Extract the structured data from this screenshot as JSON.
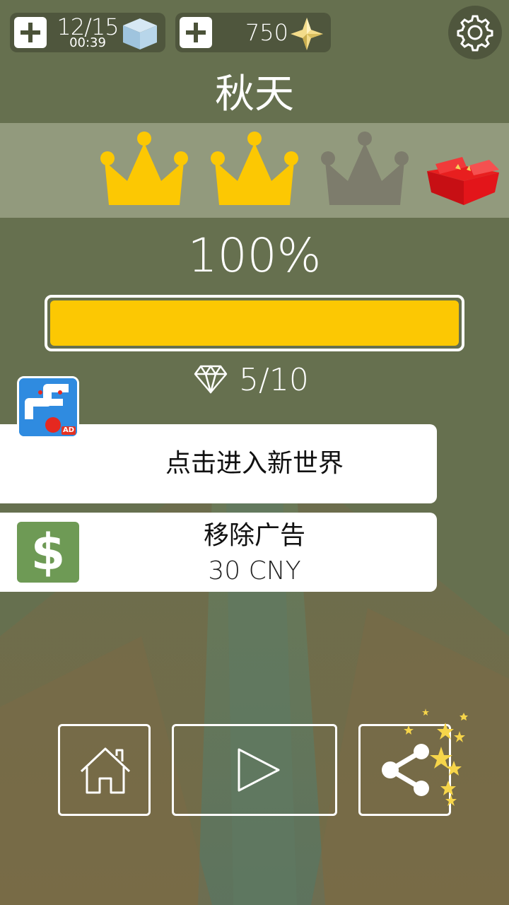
{
  "top_bar": {
    "lives": {
      "count": "12/15",
      "timer": "00:39",
      "icon": "ice-cube-icon"
    },
    "gems": {
      "count": "750",
      "icon": "star-icon"
    },
    "settings_icon": "gear-icon"
  },
  "level": {
    "title": "秋天",
    "crowns": {
      "earned": 2,
      "total": 3
    },
    "reward_icon": "gift-box-icon",
    "percent_text": "100%",
    "progress": 1.0,
    "diamonds_text": "5/10"
  },
  "ad_app": {
    "icon": "dancing-line-app-icon",
    "badge": "AD"
  },
  "enter_world": {
    "label": "点击进入新世界"
  },
  "remove_ads": {
    "label": "移除广告",
    "price": "30 CNY",
    "icon_text": "$"
  },
  "nav": {
    "home_icon": "home-icon",
    "play_icon": "play-icon",
    "share_icon": "share-icon"
  },
  "colors": {
    "background": "#66704f",
    "crown_gold": "#fcc803",
    "crown_gray": "#7d7c6c",
    "progress_fill": "#fcc803",
    "dollar_bg": "#6e9a55"
  }
}
